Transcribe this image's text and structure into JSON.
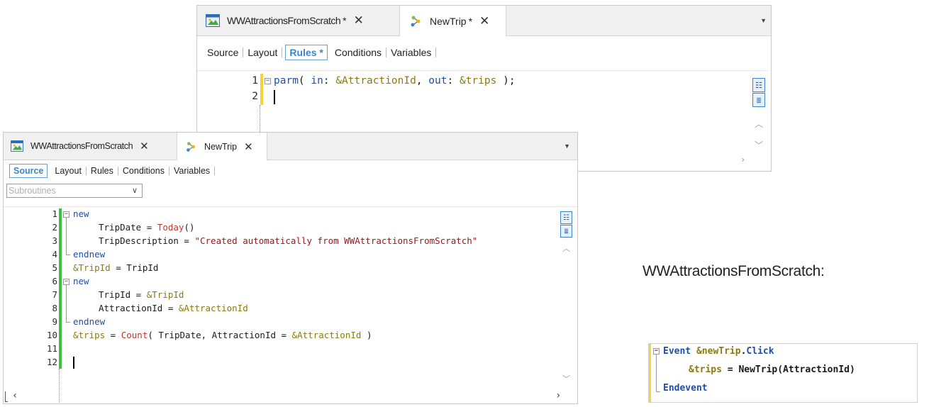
{
  "top_window": {
    "tabs": [
      {
        "label": "WWAttractionsFromScratch",
        "modified": "*"
      },
      {
        "label": "NewTrip",
        "modified": "*"
      }
    ],
    "subtabs": [
      "Source",
      "Layout",
      "Rules",
      "Conditions",
      "Variables"
    ],
    "active_subtab": "Rules",
    "active_subtab_label": "Rules *",
    "lines": [
      {
        "n": "1",
        "code": "parm( in: &AttractionId, out: &trips );"
      },
      {
        "n": "2",
        "code": ""
      }
    ]
  },
  "bottom_window": {
    "tabs": [
      {
        "label": "WWAttractionsFromScratch"
      },
      {
        "label": "NewTrip"
      }
    ],
    "subtabs": [
      "Source",
      "Layout",
      "Rules",
      "Conditions",
      "Variables"
    ],
    "active_subtab": "Source",
    "subroutines_placeholder": "Subroutines",
    "lines": [
      {
        "n": "1",
        "code": "new"
      },
      {
        "n": "2",
        "code": "TripDate = Today()"
      },
      {
        "n": "3",
        "code": "TripDescription = \"Created automatically from WWAttractionsFromScratch\""
      },
      {
        "n": "4",
        "code": "endnew"
      },
      {
        "n": "5",
        "code": "&TripId = TripId"
      },
      {
        "n": "6",
        "code": "new"
      },
      {
        "n": "7",
        "code": "TripId = &TripId"
      },
      {
        "n": "8",
        "code": "AttractionId = &AttractionId"
      },
      {
        "n": "9",
        "code": "endnew"
      },
      {
        "n": "10",
        "code": "&trips = Count( TripDate, AttractionId = &AttractionId )"
      },
      {
        "n": "11",
        "code": ""
      },
      {
        "n": "12",
        "code": ""
      }
    ]
  },
  "caption": "WWAttractionsFromScratch:",
  "event_snippet": {
    "lines": [
      "Event &newTrip.Click",
      "&trips = NewTrip(AttractionId)",
      "Endevent"
    ]
  },
  "icons": {
    "tab_web_panel": "web-panel-icon",
    "tab_procedure": "procedure-icon",
    "outline": "outline-icon",
    "format": "format-icon"
  },
  "colors": {
    "accent": "#3a86c9",
    "keyword": "#1f4ea8",
    "variable": "#8a7a12",
    "function": "#c0392b",
    "string": "#a31515",
    "change_marker": "#3cbd46",
    "edit_marker": "#f2d635"
  }
}
